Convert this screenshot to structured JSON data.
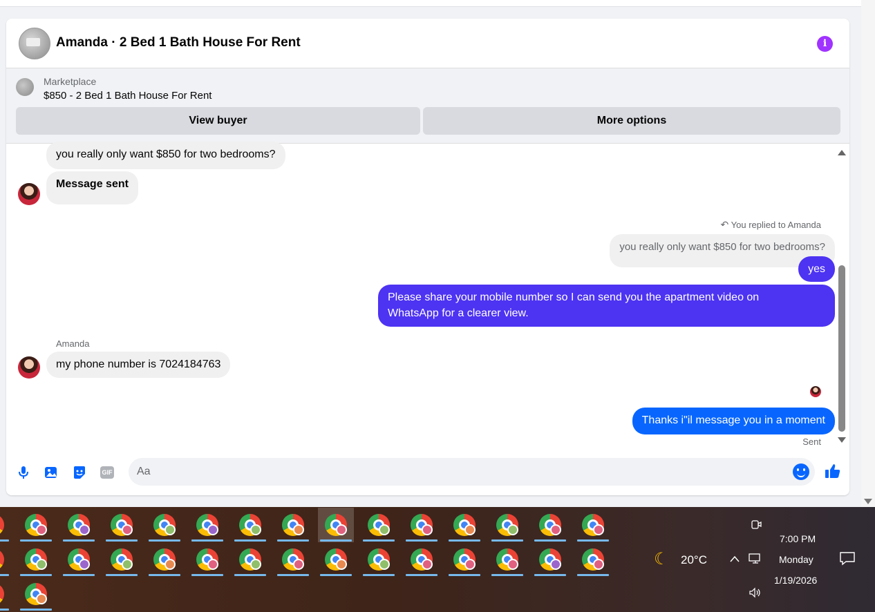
{
  "header": {
    "title": "Amanda · 2 Bed 1 Bath House For Rent",
    "info_icon": "i"
  },
  "marketplace": {
    "label": "Marketplace",
    "listing": "$850 - 2 Bed 1 Bath House For Rent",
    "view_buyer": "View buyer",
    "more_options": "More options"
  },
  "messages": {
    "m1": "you really only want $850 for two bedrooms?",
    "m2": "Message sent",
    "reply_note": "You replied to Amanda",
    "quoted": "you really only want $850 for two bedrooms?",
    "yes": "yes",
    "share_line1": "Please share your mobile number so I can send you the apartment video on",
    "share_line2": "WhatsApp for a clearer view.",
    "sender": "Amanda",
    "phone": "my phone number is 7024184763",
    "thanks": "Thanks i\"il message you in a moment",
    "status": "Sent"
  },
  "composer": {
    "placeholder": "Aa",
    "gif": "GIF"
  },
  "taskbar": {
    "weather_temp": "20°C",
    "time": "7:00 PM",
    "day": "Monday",
    "date": "1/19/2026",
    "badge_colors": [
      "#e06080",
      "#9a66cc",
      "#e06080",
      "#8fbf6a",
      "#9a66cc",
      "#8fbf6a",
      "#e88a50",
      "#e06080",
      "#8fbf6a",
      "#e06080",
      "#e88a50",
      "#8fbf6a",
      "#e06080",
      "#e06080"
    ]
  }
}
